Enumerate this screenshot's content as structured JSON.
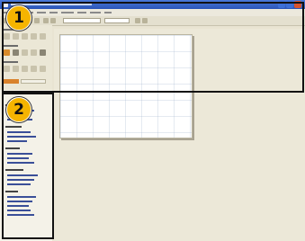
{
  "callouts": {
    "badge_1": "1",
    "badge_2": "2"
  },
  "colors": {
    "titlebar": "#2a55b8",
    "badge": "#f5b400",
    "highlight_border": "#111111",
    "canvas_background": "#ece8d8"
  },
  "icons": [
    "document-icon",
    "minimize-icon",
    "maximize-icon",
    "close-icon"
  ]
}
